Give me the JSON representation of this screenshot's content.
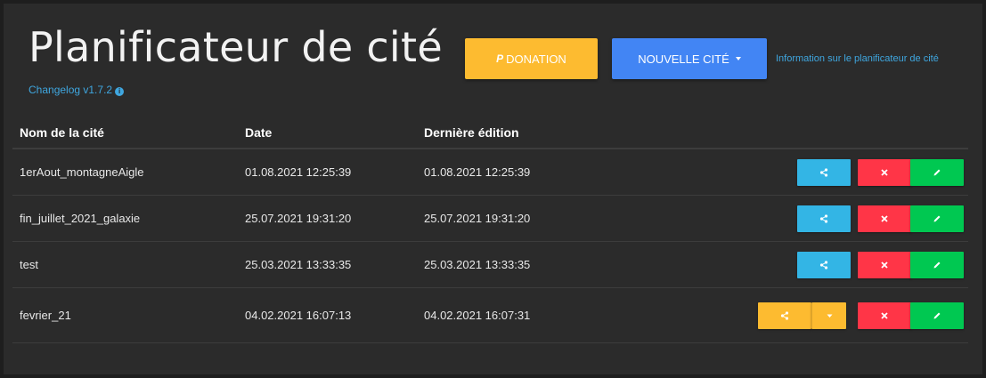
{
  "header": {
    "title": "Planificateur de cité",
    "changelog": "Changelog v1.7.2",
    "donation_icon": "P",
    "donation_label": "DONATION",
    "new_city_label": "NOUVELLE CITÉ",
    "info_link": "Information sur le planificateur de cité"
  },
  "table": {
    "columns": [
      "Nom de la cité",
      "Date",
      "Dernière édition"
    ],
    "rows": [
      {
        "name": "1erAout_montagneAigle",
        "date": "01.08.2021 12:25:39",
        "edited": "01.08.2021 12:25:39",
        "share_variant": "plain"
      },
      {
        "name": "fin_juillet_2021_galaxie",
        "date": "25.07.2021 19:31:20",
        "edited": "25.07.2021 19:31:20",
        "share_variant": "plain"
      },
      {
        "name": "test",
        "date": "25.03.2021 13:33:35",
        "edited": "25.03.2021 13:33:35",
        "share_variant": "plain"
      },
      {
        "name": "fevrier_21",
        "date": "04.02.2021 16:07:13",
        "edited": "04.02.2021 16:07:31",
        "share_variant": "dropdown"
      }
    ]
  },
  "colors": {
    "share": "#33b5e5",
    "share_shared": "#fdbb30",
    "delete": "#ff3547",
    "edit": "#00c851",
    "donation": "#fdbb30",
    "new_city": "#4285f4",
    "link": "#3fa7e0"
  },
  "icons": {
    "share": "share-icon",
    "delete": "close-icon",
    "edit": "pencil-icon",
    "info": "info-icon",
    "dropdown": "caret-down-icon",
    "donation": "paypal-icon"
  }
}
